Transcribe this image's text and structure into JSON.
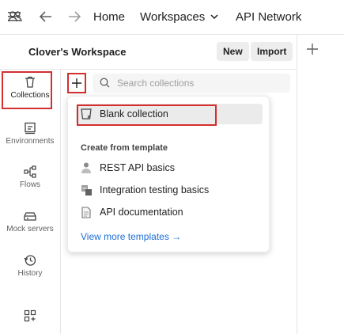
{
  "topbar": {
    "home_label": "Home",
    "workspaces_label": "Workspaces",
    "api_network_label": "API Network"
  },
  "workspace": {
    "title": "Clover's Workspace",
    "new_label": "New",
    "import_label": "Import"
  },
  "sidebar": {
    "items": [
      {
        "label": "Collections",
        "icon": "trash-can-icon"
      },
      {
        "label": "Environments",
        "icon": "environment-icon"
      },
      {
        "label": "Flows",
        "icon": "flows-icon"
      },
      {
        "label": "Mock servers",
        "icon": "mock-server-icon"
      },
      {
        "label": "History",
        "icon": "history-icon"
      }
    ]
  },
  "search": {
    "placeholder": "Search collections"
  },
  "dropdown": {
    "blank_label": "Blank collection",
    "section_label": "Create from template",
    "templates": [
      {
        "label": "REST API basics"
      },
      {
        "label": "Integration testing basics"
      },
      {
        "label": "API documentation"
      }
    ],
    "more_link": "View more templates →"
  },
  "colors": {
    "highlight": "#d32f2f",
    "link": "#1c6ed6"
  }
}
